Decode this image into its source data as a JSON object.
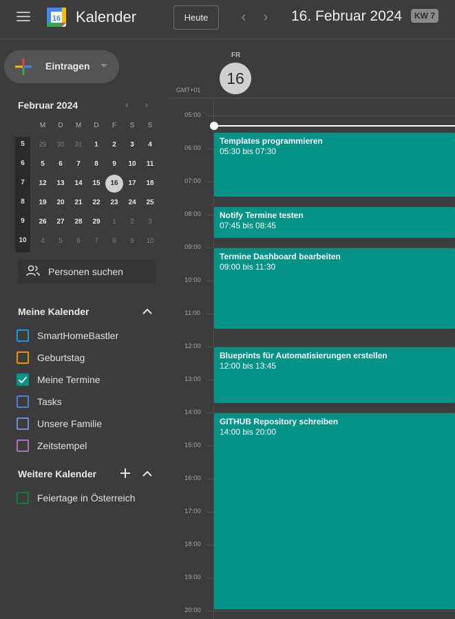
{
  "header": {
    "app_title": "Kalender",
    "logo_number": "16",
    "today_button": "Heute",
    "date_title": "16. Februar 2024",
    "week_badge": "KW 7"
  },
  "sidebar": {
    "create_label": "Eintragen",
    "mini_calendar": {
      "month_label": "Februar 2024",
      "weekdays": [
        "M",
        "D",
        "M",
        "D",
        "F",
        "S",
        "S"
      ],
      "weeks": [
        {
          "kw": "5",
          "days": [
            {
              "n": "29",
              "out": true
            },
            {
              "n": "30",
              "out": true
            },
            {
              "n": "31",
              "out": true
            },
            {
              "n": "1"
            },
            {
              "n": "2"
            },
            {
              "n": "3"
            },
            {
              "n": "4"
            }
          ]
        },
        {
          "kw": "6",
          "days": [
            {
              "n": "5"
            },
            {
              "n": "6"
            },
            {
              "n": "7"
            },
            {
              "n": "8"
            },
            {
              "n": "9"
            },
            {
              "n": "10"
            },
            {
              "n": "11"
            }
          ]
        },
        {
          "kw": "7",
          "days": [
            {
              "n": "12"
            },
            {
              "n": "13"
            },
            {
              "n": "14"
            },
            {
              "n": "15"
            },
            {
              "n": "16",
              "sel": true
            },
            {
              "n": "17"
            },
            {
              "n": "18"
            }
          ]
        },
        {
          "kw": "8",
          "days": [
            {
              "n": "19"
            },
            {
              "n": "20"
            },
            {
              "n": "21"
            },
            {
              "n": "22"
            },
            {
              "n": "23"
            },
            {
              "n": "24"
            },
            {
              "n": "25"
            }
          ]
        },
        {
          "kw": "9",
          "days": [
            {
              "n": "26"
            },
            {
              "n": "27"
            },
            {
              "n": "28"
            },
            {
              "n": "29"
            },
            {
              "n": "1",
              "out": true
            },
            {
              "n": "2",
              "out": true
            },
            {
              "n": "3",
              "out": true
            }
          ]
        },
        {
          "kw": "10",
          "days": [
            {
              "n": "4",
              "out": true
            },
            {
              "n": "5",
              "out": true
            },
            {
              "n": "6",
              "out": true
            },
            {
              "n": "7",
              "out": true
            },
            {
              "n": "8",
              "out": true
            },
            {
              "n": "9",
              "out": true
            },
            {
              "n": "10",
              "out": true
            }
          ]
        }
      ]
    },
    "people_search": "Personen suchen",
    "my_calendars_title": "Meine Kalender",
    "my_calendars": [
      {
        "label": "SmartHomeBastler",
        "color": "#1a9ae0",
        "checked": false
      },
      {
        "label": "Geburtstag",
        "color": "#f09300",
        "checked": false
      },
      {
        "label": "Meine Termine",
        "color": "#039487",
        "checked": true
      },
      {
        "label": "Tasks",
        "color": "#4b7fd9",
        "checked": false
      },
      {
        "label": "Unsere Familie",
        "color": "#7986cb",
        "checked": false
      },
      {
        "label": "Zeitstempel",
        "color": "#a479b2",
        "checked": false
      }
    ],
    "other_calendars_title": "Weitere Kalender",
    "other_calendars": [
      {
        "label": "Feiertage in Österreich",
        "color": "#0b8043",
        "checked": false
      }
    ]
  },
  "day_view": {
    "weekday": "FR",
    "day_number": "16",
    "timezone": "GMT+01",
    "hours": [
      "05:00",
      "06:00",
      "07:00",
      "08:00",
      "09:00",
      "10:00",
      "11:00",
      "12:00",
      "13:00",
      "14:00",
      "15:00",
      "16:00",
      "17:00",
      "18:00",
      "19:00",
      "20:00"
    ],
    "events": [
      {
        "title": "Templates programmieren",
        "time": "05:30 bis 07:30"
      },
      {
        "title": "Notify Termine testen",
        "time": "07:45 bis 08:45"
      },
      {
        "title": "Termine Dashboard bearbeiten",
        "time": "09:00 bis 11:30"
      },
      {
        "title": "Blueprints für Automatisierungen erstellen",
        "time": "12:00 bis 13:45"
      },
      {
        "title": "GITHUB Repository schreiben",
        "time": "14:00 bis 20:00"
      }
    ],
    "event_color": "#039487"
  }
}
